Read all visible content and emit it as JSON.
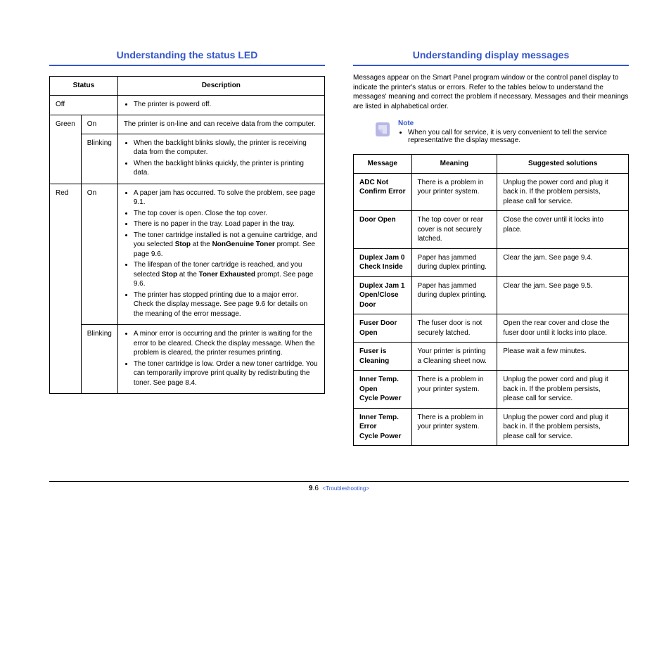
{
  "left": {
    "title": "Understanding the status LED",
    "headers": {
      "status": "Status",
      "description": "Description"
    },
    "rows": {
      "off": {
        "label": "Off",
        "desc_bullets": [
          "The printer is powerd off."
        ]
      },
      "green_on": {
        "color": "Green",
        "state": "On",
        "desc_text": "The printer is on-line and can receive data from the computer."
      },
      "green_blink": {
        "state": "Blinking",
        "desc_bullets": [
          "When the backlight blinks slowly, the printer is receiving data from the computer.",
          "When the backlight blinks quickly, the printer is printing data."
        ]
      },
      "red_on": {
        "color": "Red",
        "state": "On",
        "b1": "A paper jam has occurred. To solve the problem, see page 9.1.",
        "b2": "The top cover is open. Close the top cover.",
        "b3": "There is no paper in the tray. Load paper in the tray.",
        "b4a": "The toner cartridge installed is not a genuine cartridge, and you selected ",
        "b4_stop": "Stop",
        "b4b": " at the ",
        "b4_ng": "NonGenuine Toner",
        "b4c": " prompt. See  page 9.6.",
        "b5a": "The lifespan of the toner cartridge is reached, and you selected ",
        "b5_stop": "Stop",
        "b5b": " at the ",
        "b5_te": "Toner Exhausted",
        "b5c": " prompt. See  page 9.6.",
        "b6": "The printer has stopped printing due to a major error. Check the display message. See page 9.6 for details on the meaning of the error message."
      },
      "red_blink": {
        "state": "Blinking",
        "desc_bullets": [
          "A minor error is occurring and the printer is waiting for the error to be cleared. Check the display message. When the problem is cleared, the printer resumes printing.",
          "The toner cartridge is low. Order a new toner cartridge. You can temporarily improve print quality by redistributing the toner. See page 8.4."
        ]
      }
    }
  },
  "right": {
    "title": "Understanding display messages",
    "intro": "Messages appear on the Smart Panel program window or the control panel display to indicate the printer's status or errors. Refer to the tables below to understand the messages' meaning and correct the problem if necessary. Messages and their meanings are listed in alphabetical order.",
    "note_title": "Note",
    "note_bullet": "When you call for service, it is very convenient to tell the service representative the display message.",
    "headers": {
      "message": "Message",
      "meaning": "Meaning",
      "solutions": "Suggested solutions"
    },
    "rows": [
      {
        "msg_l1": "ADC Not",
        "msg_l2": "Confirm Error",
        "meaning": "There is a problem in your printer system.",
        "sol": "Unplug the power cord and plug it back in. If the problem persists, please call for service."
      },
      {
        "msg_l1": "Door Open",
        "msg_l2": "",
        "meaning": "The top cover or rear cover is not securely latched.",
        "sol": "Close the cover until it locks into place."
      },
      {
        "msg_l1": "Duplex Jam 0",
        "msg_l2": "Check Inside",
        "meaning": "Paper has jammed during duplex printing.",
        "sol": "Clear the jam. See page 9.4."
      },
      {
        "msg_l1": "Duplex Jam 1",
        "msg_l2": "Open/Close Door",
        "meaning": "Paper has jammed during duplex printing.",
        "sol": "Clear the jam. See page 9.5."
      },
      {
        "msg_l1": "Fuser Door Open",
        "msg_l2": "",
        "meaning": "The fuser door is not securely latched.",
        "sol": "Open the rear cover and close the fuser door until it locks into place."
      },
      {
        "msg_l1": "Fuser is Cleaning",
        "msg_l2": "",
        "meaning": "Your printer is printing a Cleaning sheet now.",
        "sol": "Please wait a few minutes."
      },
      {
        "msg_l1": "Inner Temp. Open",
        "msg_l2": "Cycle Power",
        "meaning": "There is a problem in your printer system.",
        "sol": "Unplug the power cord and plug it back in. If the problem persists, please call for service."
      },
      {
        "msg_l1": "Inner Temp. Error",
        "msg_l2": "Cycle Power",
        "meaning": "There is a problem in your printer system.",
        "sol": "Unplug the power cord and plug it back in. If the problem persists, please call for service."
      }
    ]
  },
  "footer": {
    "chapter": "9",
    "page": ".6",
    "section": "<Troubleshooting>"
  }
}
